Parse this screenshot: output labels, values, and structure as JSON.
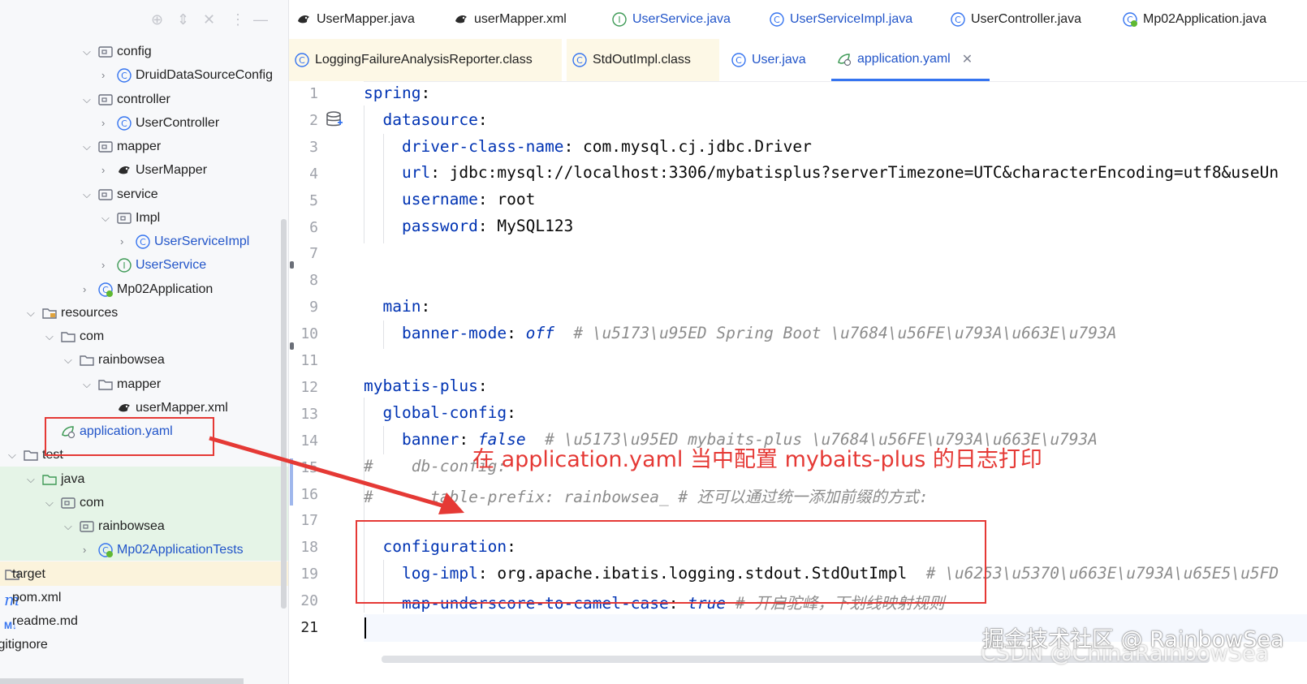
{
  "tree": {
    "rows": [
      {
        "label": "config",
        "arrow": "down",
        "icon": "package-icon"
      },
      {
        "label": "DruidDataSourceConfig",
        "arrow": "right",
        "icon": "class-icon"
      },
      {
        "label": "controller",
        "arrow": "down",
        "icon": "package-icon"
      },
      {
        "label": "UserController",
        "arrow": "right",
        "icon": "class-icon"
      },
      {
        "label": "mapper",
        "arrow": "down",
        "icon": "package-icon"
      },
      {
        "label": "UserMapper",
        "arrow": "right",
        "icon": "mybatis-icon"
      },
      {
        "label": "service",
        "arrow": "down",
        "icon": "package-icon"
      },
      {
        "label": "Impl",
        "arrow": "down",
        "icon": "package-icon"
      },
      {
        "label": "UserServiceImpl",
        "arrow": "right",
        "icon": "class-icon"
      },
      {
        "label": "UserService",
        "arrow": "right",
        "icon": "interface-icon"
      },
      {
        "label": "Mp02Application",
        "arrow": "right",
        "icon": "spring-class-icon"
      },
      {
        "label": "resources",
        "arrow": "down",
        "icon": "resources-folder-icon"
      },
      {
        "label": "com",
        "arrow": "down",
        "icon": "folder-icon"
      },
      {
        "label": "rainbowsea",
        "arrow": "down",
        "icon": "folder-icon"
      },
      {
        "label": "mapper",
        "arrow": "down",
        "icon": "folder-icon"
      },
      {
        "label": "userMapper.xml",
        "arrow": "",
        "icon": "mybatis-icon"
      },
      {
        "label": "application.yaml",
        "arrow": "",
        "icon": "yaml-icon"
      },
      {
        "label": "test",
        "arrow": "down",
        "icon": "folder-icon"
      },
      {
        "label": "java",
        "arrow": "down",
        "icon": "test-folder-icon"
      },
      {
        "label": "com",
        "arrow": "down",
        "icon": "package-icon"
      },
      {
        "label": "rainbowsea",
        "arrow": "down",
        "icon": "package-icon"
      },
      {
        "label": "Mp02ApplicationTests",
        "arrow": "right",
        "icon": "spring-class-icon"
      },
      {
        "label": "target",
        "arrow": "",
        "icon": "folder-icon"
      },
      {
        "label": "pom.xml",
        "arrow": "",
        "icon": "maven-icon"
      },
      {
        "label": "readme.md",
        "arrow": "",
        "icon": "markdown-icon"
      },
      {
        "label": ".gitignore",
        "arrow": "",
        "icon": ""
      }
    ]
  },
  "tabs_row1": [
    {
      "label": "UserMapper.java",
      "icon": "mybatis-icon"
    },
    {
      "label": "userMapper.xml",
      "icon": "mybatis-icon"
    },
    {
      "label": "UserService.java",
      "icon": "interface-icon"
    },
    {
      "label": "UserServiceImpl.java",
      "icon": "class-icon"
    },
    {
      "label": "UserController.java",
      "icon": "class-icon"
    },
    {
      "label": "Mp02Application.java",
      "icon": "spring-class-icon"
    }
  ],
  "tabs_row2": [
    {
      "label": "LoggingFailureAnalysisReporter.class",
      "icon": "class-icon"
    },
    {
      "label": "StdOutImpl.class",
      "icon": "class-icon"
    },
    {
      "label": "User.java",
      "icon": "class-icon"
    },
    {
      "label": "application.yaml",
      "icon": "yaml-icon",
      "active": true
    }
  ],
  "editor": {
    "line_numbers": [
      "1",
      "2",
      "3",
      "4",
      "5",
      "6",
      "7",
      "8",
      "9",
      "10",
      "11",
      "12",
      "13",
      "14",
      "15",
      "16",
      "17",
      "18",
      "19",
      "20",
      "21"
    ],
    "current_line": "21",
    "lines": {
      "l1_key": "spring",
      "l2_key": "datasource",
      "l3_key": "driver-class-name",
      "l3_val": "com.mysql.cj.jdbc.Driver",
      "l4_key": "url",
      "l4_val": "jdbc:mysql://localhost:3306/mybatisplus?serverTimezone=UTC&characterEncoding=utf8&useUn",
      "l5_key": "username",
      "l5_val": "root",
      "l6_key": "password",
      "l6_val": "MySQL123",
      "l9_key": "main",
      "l10_key": "banner-mode",
      "l10_val": "off",
      "l10_comment": "# \\u5173\\u95ED Spring Boot \\u7684\\u56FE\\u793A\\u663E\\u793A",
      "l12_key": "mybatis-plus",
      "l13_key": "global-config",
      "l14_key": "banner",
      "l14_val": "false",
      "l14_comment": "# \\u5173\\u95ED mybaits-plus \\u7684\\u56FE\\u793A\\u663E\\u793A",
      "l15_comment": "#    db-config:",
      "l16_comment": "#      table-prefix: rainbowsea_ # 还可以通过统一添加前缀的方式:",
      "l18_key": "configuration",
      "l19_key": "log-impl",
      "l19_val": "org.apache.ibatis.logging.stdout.StdOutImpl",
      "l19_comment": "# \\u6253\\u5370\\u663E\\u793A\\u65E5\\u5FD",
      "l20_key": "map-underscore-to-camel-case",
      "l20_val": "true",
      "l20_comment": "# 开启驼峰，下划线映射规则"
    }
  },
  "annotation": {
    "text": "在 application.yaml 当中配置 mybaits-plus 的日志打印",
    "color": "#e53935"
  },
  "watermark": {
    "line1": "掘金技术社区 @ RainbowSea",
    "line2": "CSDN @ChinaRainbowSea"
  },
  "colors": {
    "yaml_key": "#0033b3",
    "comment": "#8c8c8c",
    "accent": "#3574f0",
    "test_highlight": "#e5f4e7",
    "excluded_highlight": "#fbf3dc"
  }
}
